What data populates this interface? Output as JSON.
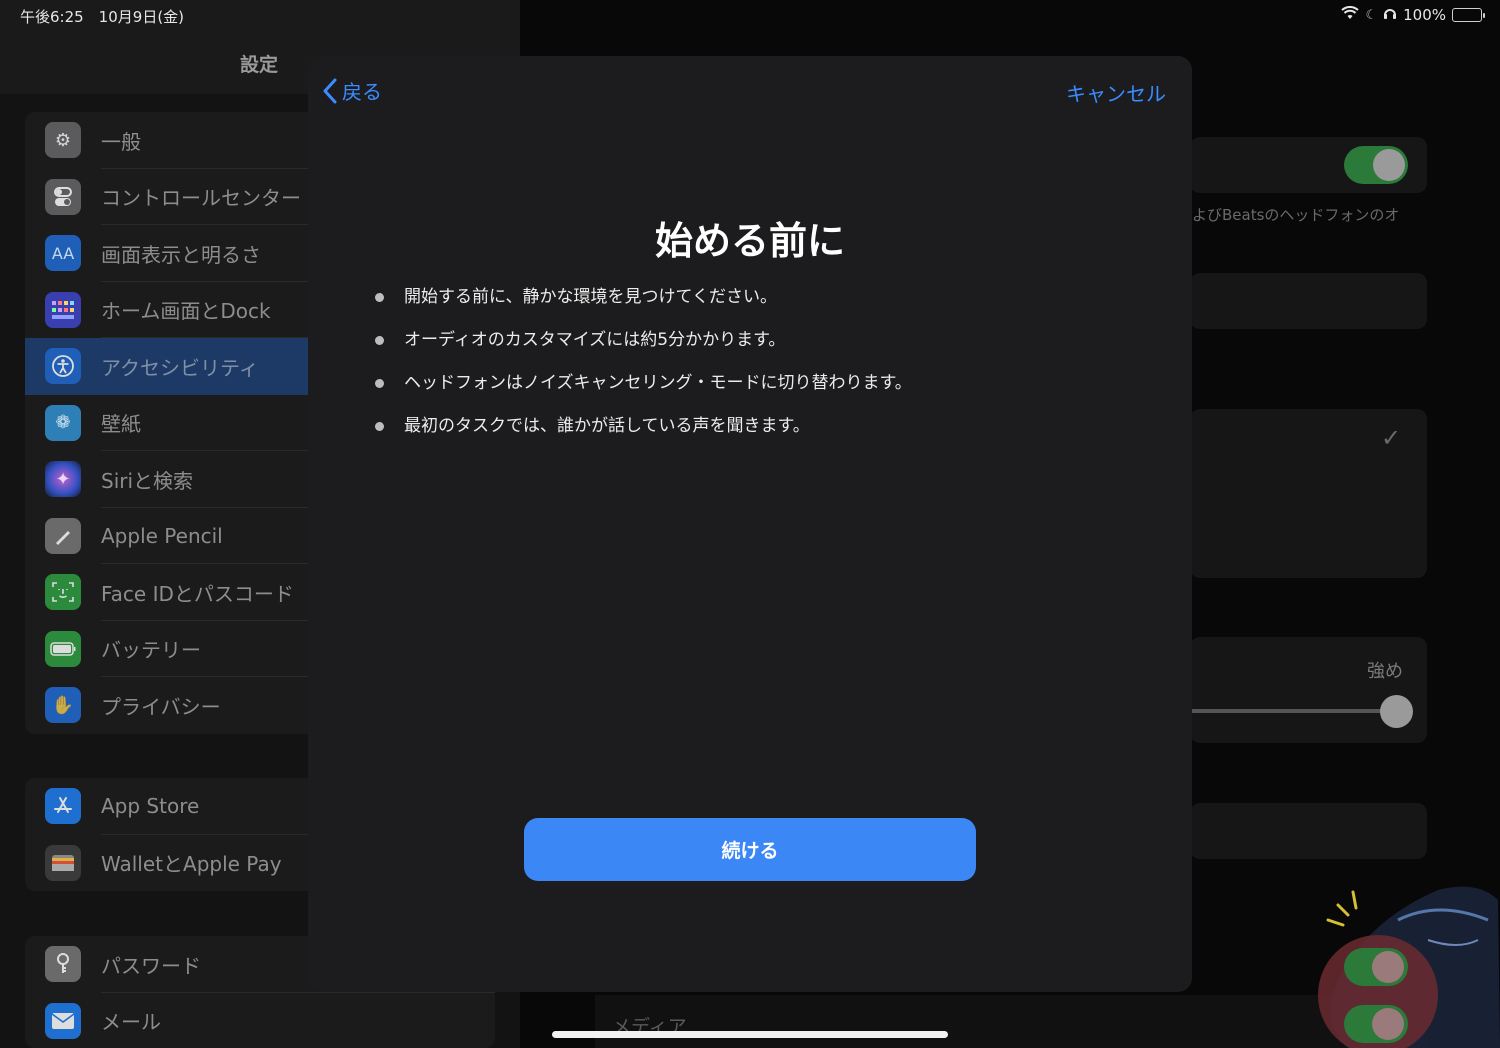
{
  "status_bar": {
    "time": "午後6:25　10月9日(金)",
    "battery": "100%"
  },
  "sidebar": {
    "title": "設定",
    "groups": [
      [
        {
          "label": "一般",
          "icon": "gear-icon",
          "color": "#5b5b5e"
        },
        {
          "label": "コントロールセンター",
          "icon": "switches-icon",
          "color": "#5b5b5e"
        },
        {
          "label": "画面表示と明るさ",
          "icon": "text-size-icon",
          "color": "#1f5fb8"
        },
        {
          "label": "ホーム画面とDock",
          "icon": "home-grid-icon",
          "color": "#3a3fb0"
        },
        {
          "label": "アクセシビリティ",
          "icon": "accessibility-icon",
          "color": "#1f5fb8",
          "selected": true
        },
        {
          "label": "壁紙",
          "icon": "flower-icon",
          "color": "#2e7fb5"
        },
        {
          "label": "Siriと検索",
          "icon": "siri-icon",
          "color": "#2a2a3a"
        },
        {
          "label": "Apple Pencil",
          "icon": "pencil-icon",
          "color": "#6a6a6a"
        },
        {
          "label": "Face IDとパスコード",
          "icon": "face-id-icon",
          "color": "#2c8a3d"
        },
        {
          "label": "バッテリー",
          "icon": "battery-icon",
          "color": "#2c8a3d"
        },
        {
          "label": "プライバシー",
          "icon": "hand-icon",
          "color": "#1f5fb8"
        }
      ],
      [
        {
          "label": "App Store",
          "icon": "app-store-icon",
          "color": "#1f6fd0"
        },
        {
          "label": "WalletとApple Pay",
          "icon": "wallet-icon",
          "color": "#3a3a3a"
        }
      ],
      [
        {
          "label": "パスワード",
          "icon": "key-icon",
          "color": "#6a6a6a"
        },
        {
          "label": "メール",
          "icon": "mail-icon",
          "color": "#1f6fd0"
        }
      ]
    ]
  },
  "detail": {
    "beats_note": "よびBeatsのヘッドフォンのオ",
    "slider_label": "強め",
    "media_label": "メディア"
  },
  "modal": {
    "back_label": "戻る",
    "cancel_label": "キャンセル",
    "title": "始める前に",
    "bullets": [
      "開始する前に、静かな環境を見つけてください。",
      "オーディオのカスタマイズには約5分かかります。",
      "ヘッドフォンはノイズキャンセリング・モードに切り替わります。",
      "最初のタスクでは、誰かが話している声を聞きます。"
    ],
    "continue_label": "続ける"
  },
  "colors": {
    "accent": "#3a87f5",
    "link": "#3a8cff",
    "modal_bg": "#1c1c1e"
  }
}
